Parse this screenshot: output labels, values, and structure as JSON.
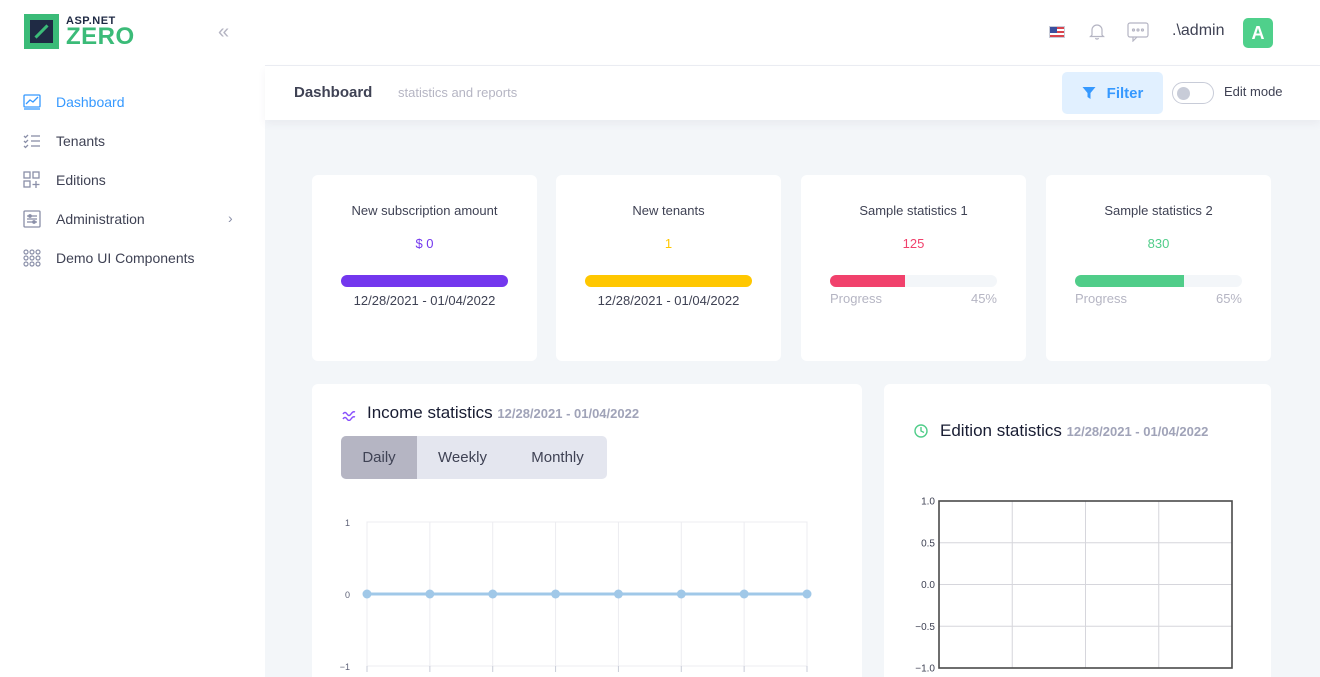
{
  "brand": {
    "line1": "ASP.NET",
    "line2": "ZERO"
  },
  "sidebar": {
    "collapse_glyph": "«",
    "items": [
      {
        "label": "Dashboard",
        "icon": "chart-line-icon",
        "active": true
      },
      {
        "label": "Tenants",
        "icon": "list-check-icon"
      },
      {
        "label": "Editions",
        "icon": "grid-add-icon"
      },
      {
        "label": "Administration",
        "icon": "sliders-icon",
        "has_children": true
      },
      {
        "label": "Demo UI Components",
        "icon": "dots-grid-icon"
      }
    ]
  },
  "topbar": {
    "username": ".\\admin",
    "avatar_letter": "A",
    "language": "flag-us-icon"
  },
  "subheader": {
    "title": "Dashboard",
    "subtitle": "statistics and reports",
    "filter_label": "Filter",
    "edit_mode_label": "Edit mode"
  },
  "stats": [
    {
      "title": "New subscription amount",
      "value": "$ 0",
      "date": "12/28/2021 - 01/04/2022",
      "color": "#7337ee"
    },
    {
      "title": "New tenants",
      "value": "1",
      "date": "12/28/2021 - 01/04/2022",
      "color": "#ffc700"
    },
    {
      "title": "Sample statistics 1",
      "value": "125",
      "progress_label": "Progress",
      "progress": "45%",
      "progress_fraction": 0.45,
      "color": "#f1416c"
    },
    {
      "title": "Sample statistics 2",
      "value": "830",
      "progress_label": "Progress",
      "progress": "65%",
      "progress_fraction": 0.65,
      "color": "#50cd89"
    }
  ],
  "income": {
    "title": "Income statistics",
    "date": "12/28/2021 - 01/04/2022",
    "periods": [
      "Daily",
      "Weekly",
      "Monthly"
    ],
    "active_period": "Daily"
  },
  "edition": {
    "title": "Edition statistics",
    "date": "12/28/2021 - 01/04/2022"
  },
  "chart_data": [
    {
      "type": "line",
      "series": [
        {
          "values": [
            0,
            0,
            0,
            0,
            0,
            0,
            0,
            0
          ]
        }
      ],
      "ylim": [
        -1,
        1
      ],
      "yticks": [
        "1",
        "0",
        "−1"
      ],
      "grid": true,
      "color": "#a0c8e8"
    },
    {
      "type": "line",
      "series": [],
      "ylim": [
        -1.0,
        1.0
      ],
      "yticks": [
        "1.0",
        "0.5",
        "0.0",
        "−0.5",
        "−1.0"
      ],
      "grid": true
    }
  ]
}
